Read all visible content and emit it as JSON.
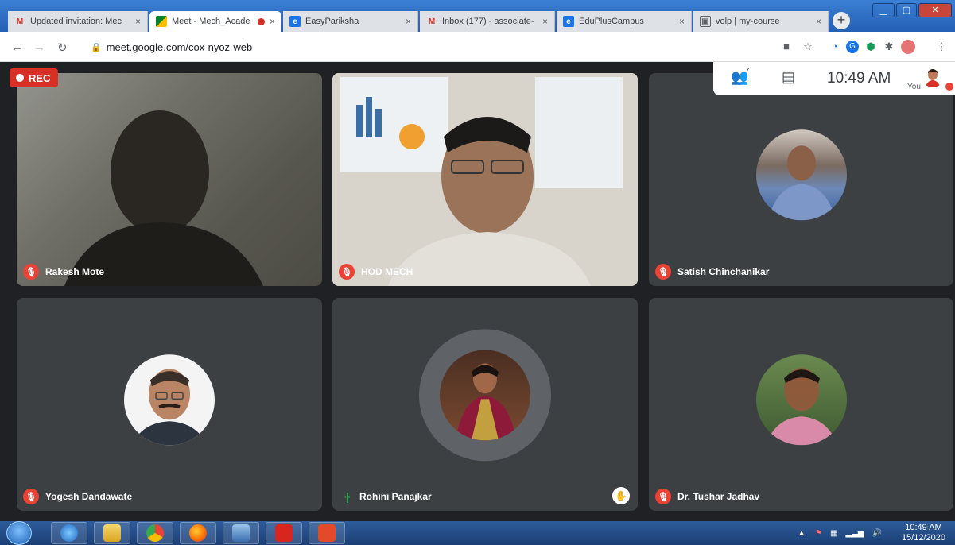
{
  "browser": {
    "tabs": [
      {
        "title": "Updated invitation: Mec",
        "favicon": "gmail-icon",
        "active": false
      },
      {
        "title": "Meet - Mech_Acade",
        "favicon": "google-meet-icon",
        "active": true,
        "recording": true
      },
      {
        "title": "EasyPariksha",
        "favicon": "easypariksha-icon",
        "active": false
      },
      {
        "title": "Inbox (177) - associate-",
        "favicon": "gmail-icon",
        "active": false
      },
      {
        "title": "EduPlusCampus",
        "favicon": "eduplus-icon",
        "active": false
      },
      {
        "title": "volp | my-course",
        "favicon": "volp-icon",
        "active": false
      }
    ],
    "tab_close": "×",
    "new_tab": "+",
    "url": "meet.google.com/cox-nyoz-web"
  },
  "meet": {
    "rec_label": "REC",
    "participant_count": "7",
    "time": "10:49 AM",
    "self_label": "You",
    "participants": [
      {
        "name": "Rakesh Mote",
        "muted": true,
        "video": true
      },
      {
        "name": "HOD MECH",
        "muted": true,
        "video": true
      },
      {
        "name": "Satish Chinchanikar",
        "muted": true,
        "video": false
      },
      {
        "name": "Yogesh Dandawate",
        "muted": true,
        "video": false
      },
      {
        "name": "Rohini Panajkar",
        "muted": false,
        "speaking": true,
        "hand_raised": true,
        "video": false
      },
      {
        "name": "Dr. Tushar Jadhav",
        "muted": true,
        "video": false
      }
    ]
  },
  "taskbar": {
    "apps": [
      "internet-explorer-icon",
      "file-explorer-icon",
      "chrome-icon",
      "firefox-icon",
      "festo-icon",
      "acrobat-icon",
      "ec-app-icon"
    ],
    "clock_time": "10:49 AM",
    "clock_date": "15/12/2020"
  },
  "colors": {
    "meet_bg": "#202124",
    "tile_bg": "#3c4043",
    "mic_off": "#ea4335",
    "rec": "#d93025"
  }
}
